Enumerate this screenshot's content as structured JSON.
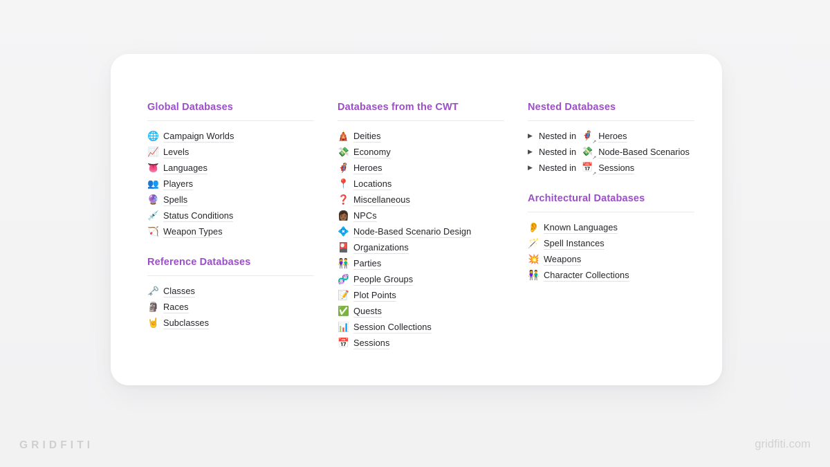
{
  "brand": {
    "wordmark": "GRIDFITI",
    "url": "gridfiti.com"
  },
  "theme": {
    "heading_color": "#9b4fc8",
    "text_color": "#25252a",
    "page_background": "#f4f4f5",
    "card_background": "#ffffff",
    "divider_color": "#eaeaec",
    "underline_color": "#e2e2e4",
    "watermark_color": "#d0d0d3"
  },
  "columns": [
    {
      "id": "column-left",
      "sections": [
        {
          "id": "global-databases",
          "heading": "Global Databases",
          "type": "page-list",
          "items": [
            {
              "icon": "🌐",
              "icon_name": "globe-icon",
              "label": "Campaign Worlds"
            },
            {
              "icon": "📈",
              "icon_name": "chart-increasing-icon",
              "label": "Levels"
            },
            {
              "icon": "👅",
              "icon_name": "tongue-icon",
              "label": "Languages"
            },
            {
              "icon": "👥",
              "icon_name": "busts-in-silhouette-icon",
              "label": "Players"
            },
            {
              "icon": "🔮",
              "icon_name": "crystal-ball-icon",
              "label": "Spells"
            },
            {
              "icon": "💉",
              "icon_name": "syringe-icon",
              "label": "Status Conditions"
            },
            {
              "icon": "🏹",
              "icon_name": "bow-and-arrow-icon",
              "label": "Weapon Types"
            }
          ]
        },
        {
          "id": "reference-databases",
          "heading": "Reference Databases",
          "type": "page-list",
          "items": [
            {
              "icon": "🗝️",
              "icon_name": "old-key-icon",
              "label": "Classes"
            },
            {
              "icon": "🗿",
              "icon_name": "moai-icon",
              "label": "Races"
            },
            {
              "icon": "🤘",
              "icon_name": "sign-of-the-horns-icon",
              "label": "Subclasses"
            }
          ]
        }
      ]
    },
    {
      "id": "column-middle",
      "sections": [
        {
          "id": "databases-from-the-cwt",
          "heading": "Databases from the CWT",
          "type": "page-list",
          "items": [
            {
              "icon": "🛕",
              "icon_name": "hindu-temple-icon",
              "label": "Deities"
            },
            {
              "icon": "💸",
              "icon_name": "money-with-wings-icon",
              "label": "Economy"
            },
            {
              "icon": "🦸",
              "icon_name": "superhero-icon",
              "label": "Heroes"
            },
            {
              "icon": "📍",
              "icon_name": "round-pushpin-icon",
              "label": "Locations"
            },
            {
              "icon": "❓",
              "icon_name": "question-mark-icon",
              "label": "Miscellaneous"
            },
            {
              "icon": "👩🏾",
              "icon_name": "woman-icon",
              "label": "NPCs"
            },
            {
              "icon": "💠",
              "icon_name": "diamond-with-a-dot-icon",
              "label": "Node-Based Scenario Design"
            },
            {
              "icon": "🎴",
              "icon_name": "flower-playing-cards-icon",
              "label": "Organizations"
            },
            {
              "icon": "👫",
              "icon_name": "man-and-woman-holding-hands-icon",
              "label": "Parties"
            },
            {
              "icon": "🧬",
              "icon_name": "dna-icon",
              "label": "People Groups"
            },
            {
              "icon": "📝",
              "icon_name": "memo-icon",
              "label": "Plot Points"
            },
            {
              "icon": "✅",
              "icon_name": "check-mark-button-icon",
              "label": "Quests"
            },
            {
              "icon": "📊",
              "icon_name": "bar-chart-icon",
              "label": "Session Collections"
            },
            {
              "icon": "📅",
              "icon_name": "calendar-icon",
              "label": "Sessions"
            }
          ]
        }
      ]
    },
    {
      "id": "column-right",
      "sections": [
        {
          "id": "nested-databases",
          "heading": "Nested Databases",
          "type": "toggle-list",
          "items": [
            {
              "toggle": "▶",
              "prefix": "Nested in",
              "icon": "🦸",
              "icon_name": "superhero-icon",
              "label": "Heroes"
            },
            {
              "toggle": "▶",
              "prefix": "Nested in",
              "icon": "💸",
              "icon_name": "money-with-wings-icon",
              "label": "Node-Based Scenarios"
            },
            {
              "toggle": "▶",
              "prefix": "Nested in",
              "icon": "📅",
              "icon_name": "calendar-icon",
              "label": "Sessions"
            }
          ]
        },
        {
          "id": "architectural-databases",
          "heading": "Architectural Databases",
          "type": "page-list",
          "items": [
            {
              "icon": "👂",
              "icon_name": "ear-icon",
              "label": "Known Languages"
            },
            {
              "icon": "🪄",
              "icon_name": "magic-wand-icon",
              "label": "Spell Instances"
            },
            {
              "icon": "💥",
              "icon_name": "collision-icon",
              "label": "Weapons"
            },
            {
              "icon": "👫",
              "icon_name": "man-and-woman-holding-hands-icon",
              "label": "Character Collections"
            }
          ]
        }
      ]
    }
  ]
}
